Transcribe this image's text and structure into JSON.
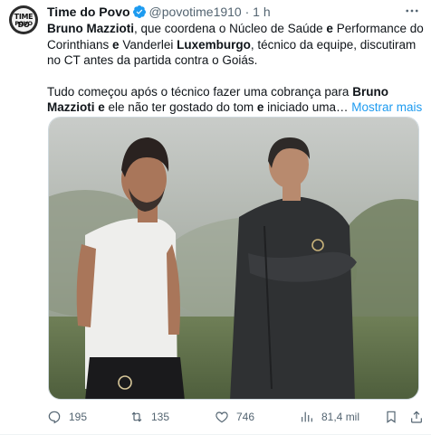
{
  "author": {
    "name": "Time do Povo",
    "handle": "@povotime1910",
    "separator": "·",
    "time": "1 h",
    "avatar_text_top": "TIME DO",
    "avatar_text_bottom": "POVO"
  },
  "tweet": {
    "p1_b1": "Bruno Mazzioti",
    "p1_t1": ", que coordena o Núcleo de Saúde ",
    "p1_b2": "e",
    "p1_t2": " Performance do Corinthians ",
    "p1_b3": "e",
    "p1_t3": " Vanderlei ",
    "p1_b4": "Luxemburgo",
    "p1_t4": ", técnico da equipe, discutiram no CT antes da partida contra o Goiás.",
    "p2_t1": "Tudo começou após o técnico fazer uma cobrança para ",
    "p2_b1": "Bruno Mazzioti",
    "p2_b2": " e",
    "p2_t2": " ele não ter gostado do tom ",
    "p2_b3": "e",
    "p2_t3": " iniciado uma… ",
    "show_more": "Mostrar mais"
  },
  "actions": {
    "replies": "195",
    "retweets": "135",
    "likes": "746",
    "views": "81,4 mil"
  },
  "colors": {
    "text": "#0f1419",
    "secondary": "#536471",
    "link": "#1d9bf0",
    "verified": "#1d9bf0"
  },
  "icons": {
    "verified": "verified-badge-icon",
    "more": "more-horizontal-icon",
    "reply": "reply-icon",
    "retweet": "retweet-icon",
    "like": "heart-icon",
    "views": "bar-chart-icon",
    "bookmark": "bookmark-icon",
    "share": "share-icon"
  }
}
